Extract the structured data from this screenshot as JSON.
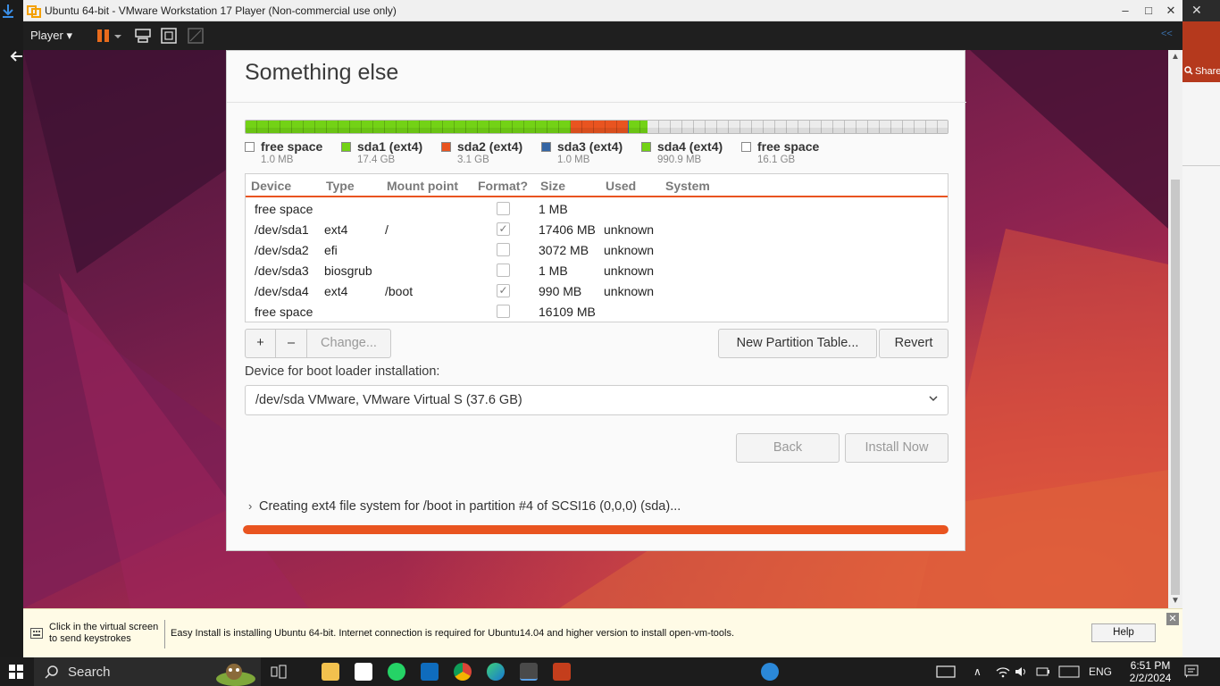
{
  "window": {
    "title": "Ubuntu 64-bit - VMware Workstation 17 Player (Non-commercial use only)",
    "minimize": "–",
    "maximize": "□",
    "close": "✕",
    "outer_close": "✕"
  },
  "toolbar": {
    "player_label": "Player",
    "icons": [
      "pause-icon",
      "send-ctrl-alt-del-icon",
      "fullscreen-icon",
      "unity-icon"
    ],
    "collapse": "<<"
  },
  "installer": {
    "title": "Something else",
    "partition_bar": {
      "segments": [
        {
          "name": "sda1",
          "color": "#73d216",
          "fraction": 0.4625
        },
        {
          "name": "sda2",
          "color": "#e95420",
          "fraction": 0.0815
        },
        {
          "name": "sda3",
          "color": "#3465a4",
          "fraction": 0.0001
        },
        {
          "name": "sda4",
          "color": "#73d216",
          "fraction": 0.0263
        },
        {
          "name": "free space",
          "color": "#ececec",
          "fraction": 0.4296
        }
      ]
    },
    "legend": [
      {
        "name": "free space",
        "size": "1.0 MB",
        "color": "#ffffff"
      },
      {
        "name": "sda1 (ext4)",
        "size": "17.4 GB",
        "color": "#73d216"
      },
      {
        "name": "sda2 (ext4)",
        "size": "3.1 GB",
        "color": "#e95420"
      },
      {
        "name": "sda3 (ext4)",
        "size": "1.0 MB",
        "color": "#3465a4"
      },
      {
        "name": "sda4 (ext4)",
        "size": "990.9 MB",
        "color": "#73d216"
      },
      {
        "name": "free space",
        "size": "16.1 GB",
        "color": "#ffffff"
      }
    ],
    "table": {
      "headers": [
        "Device",
        "Type",
        "Mount point",
        "Format?",
        "Size",
        "Used",
        "System"
      ],
      "rows": [
        {
          "device": "free space",
          "type": "",
          "mount": "",
          "format": false,
          "size": "1 MB",
          "used": ""
        },
        {
          "device": "/dev/sda1",
          "type": "ext4",
          "mount": "/",
          "format": true,
          "size": "17406 MB",
          "used": "unknown"
        },
        {
          "device": "/dev/sda2",
          "type": "efi",
          "mount": "",
          "format": false,
          "size": "3072 MB",
          "used": "unknown"
        },
        {
          "device": "/dev/sda3",
          "type": "biosgrub",
          "mount": "",
          "format": false,
          "size": "1 MB",
          "used": "unknown"
        },
        {
          "device": "/dev/sda4",
          "type": "ext4",
          "mount": "/boot",
          "format": true,
          "size": "990 MB",
          "used": "unknown"
        },
        {
          "device": "free space",
          "type": "",
          "mount": "",
          "format": false,
          "size": "16109 MB",
          "used": ""
        }
      ]
    },
    "buttons": {
      "add": "+",
      "remove": "–",
      "change": "Change...",
      "new_table": "New Partition Table...",
      "revert": "Revert",
      "back": "Back",
      "install": "Install Now"
    },
    "bootloader_label": "Device for boot loader installation:",
    "bootloader_value": "/dev/sda   VMware, VMware Virtual S (37.6 GB)",
    "status_text": "Creating ext4 file system for /boot in partition #4 of SCSI16 (0,0,0) (sda)...",
    "progress": 1.0
  },
  "infobar": {
    "hint": "Click in the virtual screen to send keystrokes",
    "message": "Easy Install is installing Ubuntu 64-bit. Internet connection is required for Ubuntu14.04 and higher version to install open-vm-tools.",
    "help": "Help"
  },
  "right_panel": {
    "share": "Share"
  },
  "taskbar": {
    "search_placeholder": "Search",
    "lang": "ENG",
    "time": "6:51 PM",
    "date": "2/2/2024"
  },
  "colors": {
    "accent": "#e95420",
    "green": "#73d216",
    "blue": "#3465a4"
  }
}
